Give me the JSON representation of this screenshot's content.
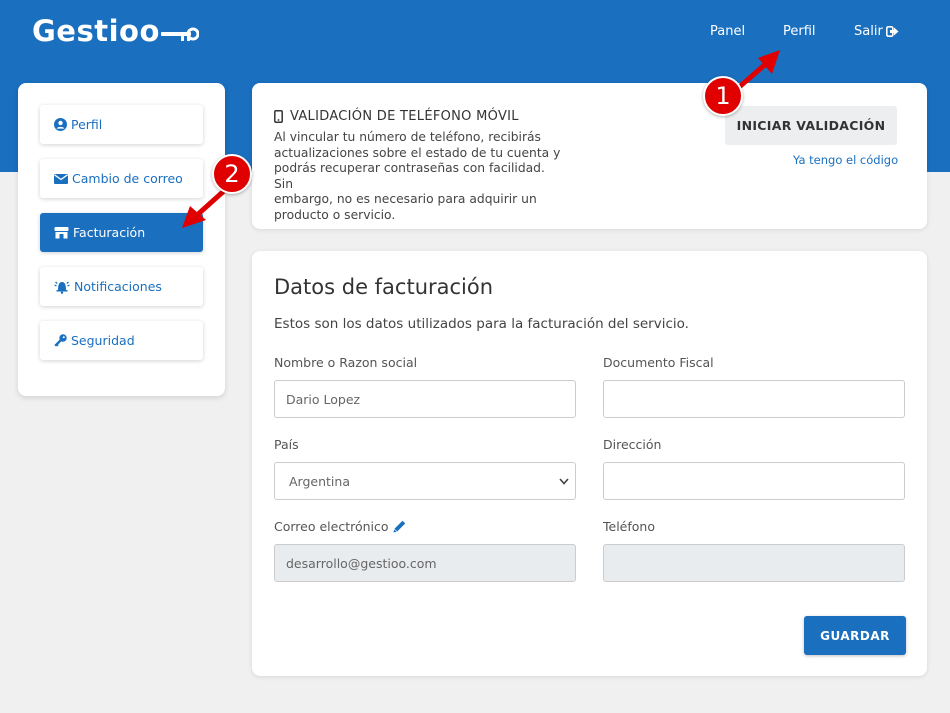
{
  "brand": {
    "logo_text": "Gestioo",
    "primary_color": "#1a6fbf",
    "annotation_color": "#e00000"
  },
  "topnav": {
    "panel": "Panel",
    "perfil": "Perfil",
    "salir": "Salir"
  },
  "sidebar": {
    "items": [
      {
        "label": "Perfil",
        "icon": "user-circle-icon"
      },
      {
        "label": "Cambio de correo",
        "icon": "envelope-icon"
      },
      {
        "label": "Facturación",
        "icon": "store-icon",
        "active": true
      },
      {
        "label": "Notificaciones",
        "icon": "bell-icon"
      },
      {
        "label": "Seguridad",
        "icon": "key-icon"
      }
    ]
  },
  "validation": {
    "title": "VALIDACIÓN DE TELÉFONO MÓVIL",
    "line1": "Al vincular tu número de teléfono, recibirás",
    "line2": "actualizaciones sobre el estado de tu cuenta y",
    "line3": "podrás recuperar contraseñas con facilidad. Sin",
    "line4": "embargo, no es necesario para adquirir un",
    "line5": "producto o servicio.",
    "button": "INICIAR VALIDACIÓN",
    "link": "Ya tengo el código"
  },
  "billing": {
    "title": "Datos de facturación",
    "subtitle": "Estos son los datos utilizados para la facturación del servicio.",
    "name_label": "Nombre o Razon social",
    "name_value": "Dario Lopez",
    "doc_label": "Documento Fiscal",
    "doc_value": "",
    "country_label": "País",
    "country_value": "Argentina",
    "address_label": "Dirección",
    "address_value": "",
    "email_label": "Correo electrónico",
    "email_value": "desarrollo@gestioo.com",
    "phone_label": "Teléfono",
    "phone_value": "",
    "save_button": "GUARDAR"
  },
  "annotations": {
    "one": "1",
    "two": "2"
  }
}
